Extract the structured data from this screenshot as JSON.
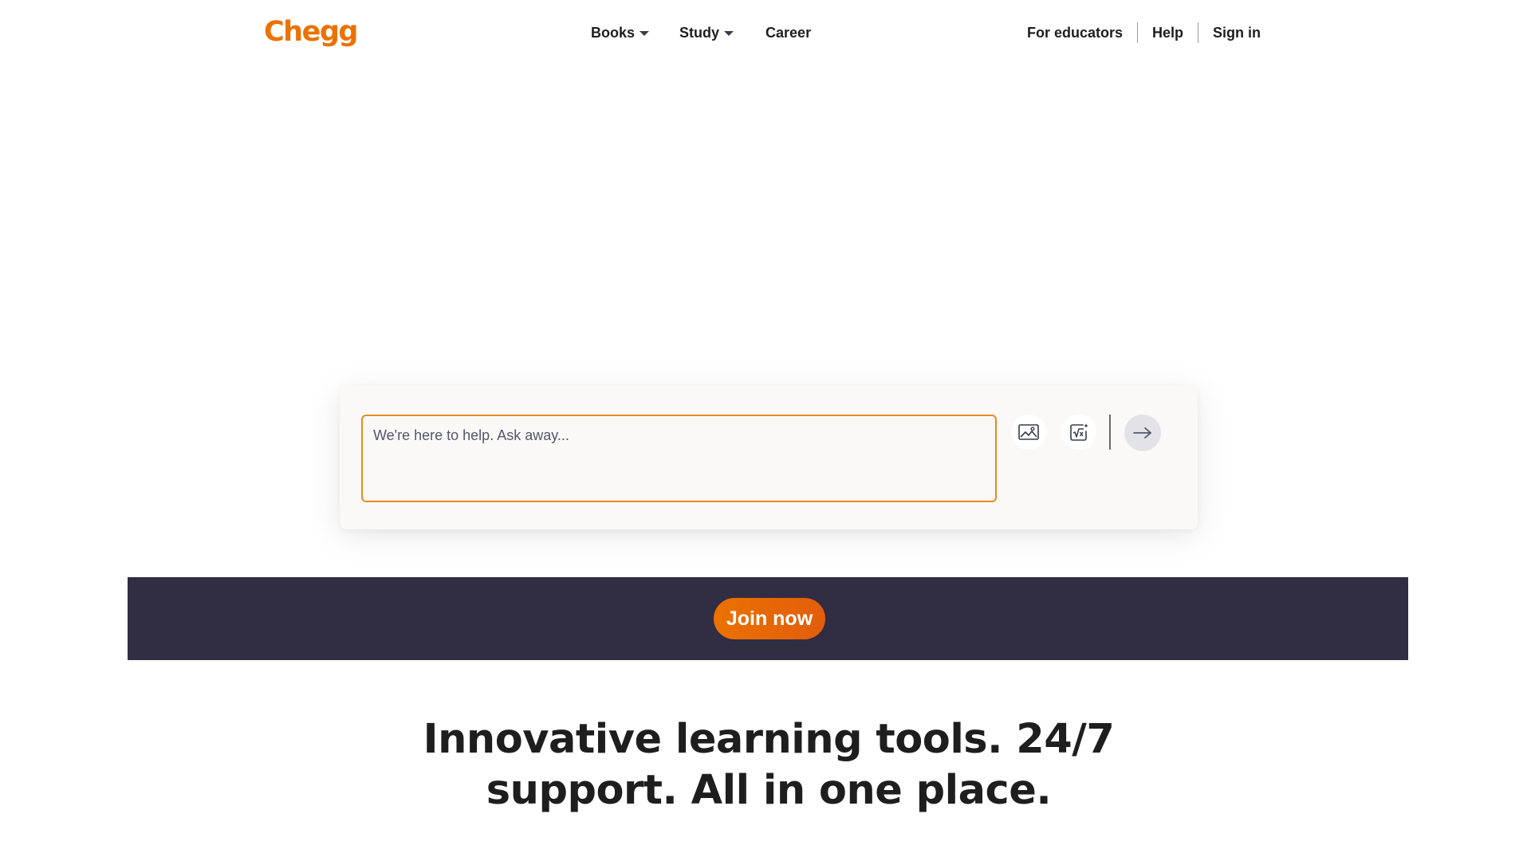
{
  "brand": {
    "logo_text": "Chegg",
    "accent_color": "#eb7100",
    "dark_color": "#312d42"
  },
  "header": {
    "nav": [
      {
        "label": "Books",
        "has_dropdown": true
      },
      {
        "label": "Study",
        "has_dropdown": true
      },
      {
        "label": "Career",
        "has_dropdown": false
      }
    ],
    "right_links": [
      {
        "label": "For educators"
      },
      {
        "label": "Help"
      },
      {
        "label": "Sign in"
      }
    ]
  },
  "search": {
    "placeholder": "We're here to help. Ask away...",
    "value": "",
    "image_tool_icon": "image-upload-icon",
    "math_tool_icon": "math-formula-icon",
    "submit_icon": "arrow-right-icon"
  },
  "banner": {
    "join_label": "Join now"
  },
  "headline": {
    "line1": "Innovative learning tools. 24/7",
    "line2": "support. All in one place."
  }
}
